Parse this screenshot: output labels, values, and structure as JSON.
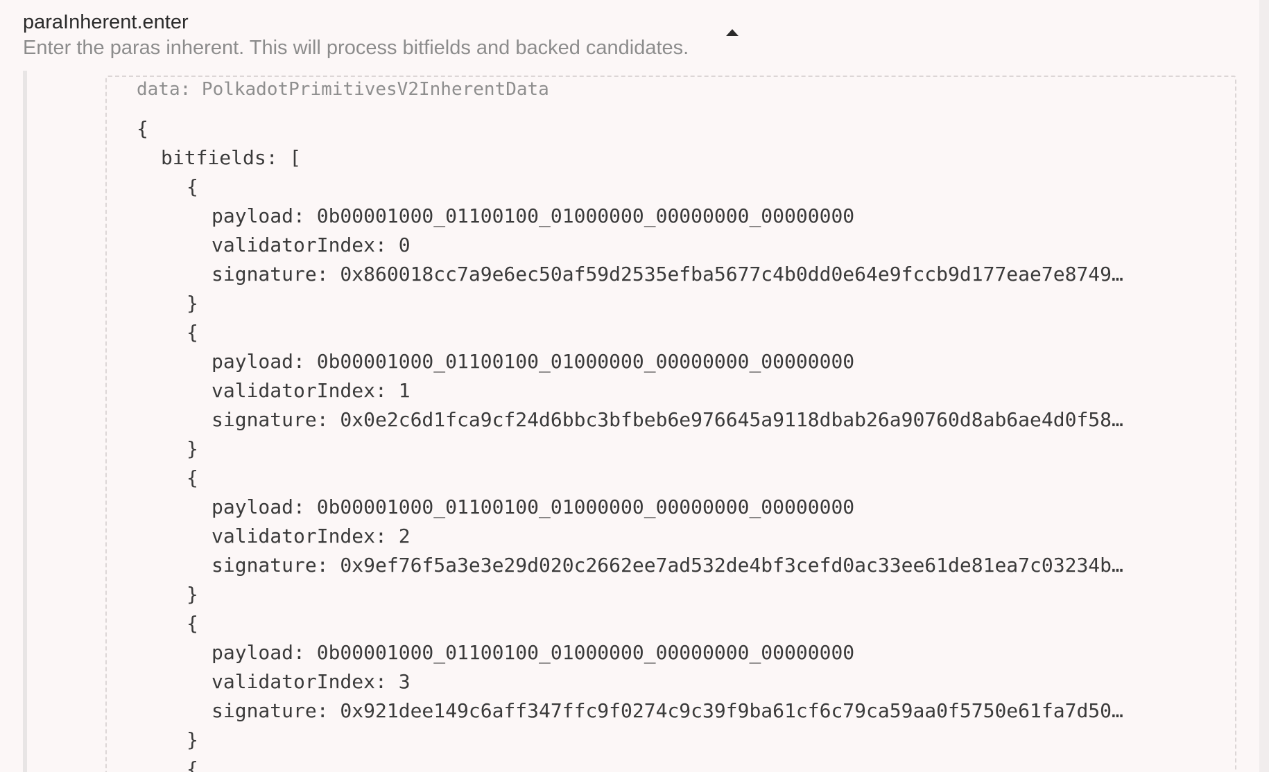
{
  "call": {
    "name": "paraInherent.enter",
    "doc": "Enter the paras inherent. This will process bitfields and backed candidates."
  },
  "param": {
    "label": "data: PolkadotPrimitivesV2InherentData"
  },
  "code": {
    "open_brace": "{",
    "bitfields_key": "bitfields: [",
    "items": [
      {
        "open": "{",
        "payload": "payload: 0b00001000_01100100_01000000_00000000_00000000",
        "validatorIndex": "validatorIndex: 0",
        "signature": "signature: 0x860018cc7a9e6ec50af59d2535efba5677c4b0dd0e64e9fccb9d177eae7e8749…",
        "close": "}"
      },
      {
        "open": "{",
        "payload": "payload: 0b00001000_01100100_01000000_00000000_00000000",
        "validatorIndex": "validatorIndex: 1",
        "signature": "signature: 0x0e2c6d1fca9cf24d6bbc3bfbeb6e976645a9118dbab26a90760d8ab6ae4d0f58…",
        "close": "}"
      },
      {
        "open": "{",
        "payload": "payload: 0b00001000_01100100_01000000_00000000_00000000",
        "validatorIndex": "validatorIndex: 2",
        "signature": "signature: 0x9ef76f5a3e3e29d020c2662ee7ad532de4bf3cefd0ac33ee61de81ea7c03234b…",
        "close": "}"
      },
      {
        "open": "{",
        "payload": "payload: 0b00001000_01100100_01000000_00000000_00000000",
        "validatorIndex": "validatorIndex: 3",
        "signature": "signature: 0x921dee149c6aff347ffc9f0274c9c39f9ba61cf6c79ca59aa0f5750e61fa7d50…",
        "close": "}"
      }
    ],
    "next_open": "{"
  },
  "icons": {
    "collapse": "caret-up-icon"
  },
  "colors": {
    "background": "#fcf7f7",
    "text": "#3a3a3a",
    "muted": "#8c8c8c"
  }
}
